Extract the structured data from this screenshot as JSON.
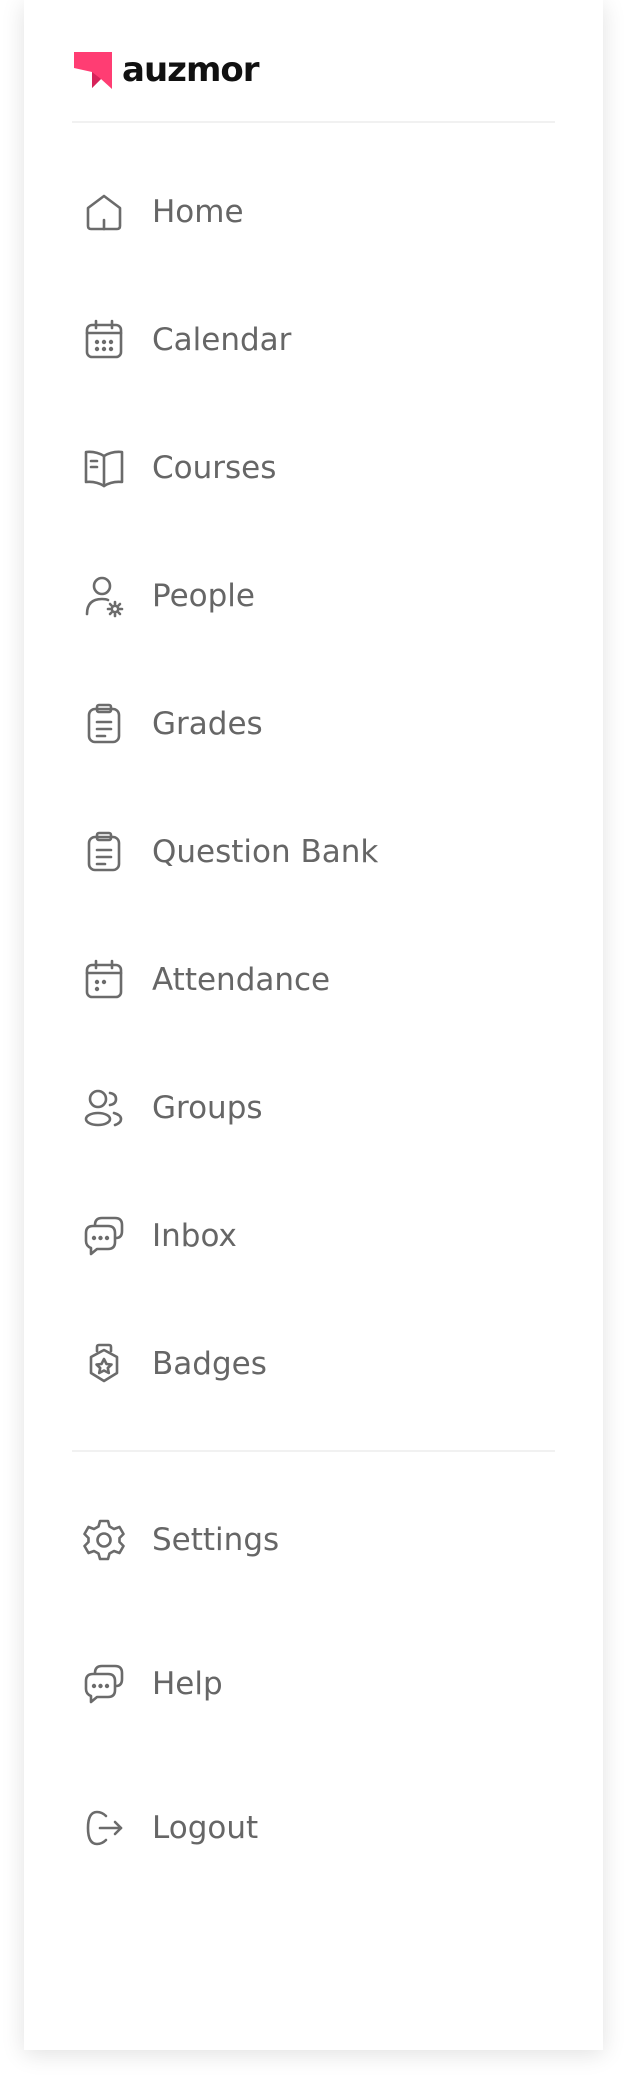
{
  "brand": {
    "name": "auzmor",
    "accent_color": "#ff3d73"
  },
  "colors": {
    "icon_stroke": "#6b6b6b",
    "label": "#666666",
    "divider": "#f1f1f1"
  },
  "nav": {
    "items": [
      {
        "label": "Home",
        "icon": "home-icon"
      },
      {
        "label": "Calendar",
        "icon": "calendar-icon"
      },
      {
        "label": "Courses",
        "icon": "book-open-icon"
      },
      {
        "label": "People",
        "icon": "user-gear-icon"
      },
      {
        "label": "Grades",
        "icon": "clipboard-icon"
      },
      {
        "label": "Question Bank",
        "icon": "clipboard-icon"
      },
      {
        "label": "Attendance",
        "icon": "calendar-check-icon"
      },
      {
        "label": "Groups",
        "icon": "users-icon"
      },
      {
        "label": "Inbox",
        "icon": "chat-bubbles-icon"
      },
      {
        "label": "Badges",
        "icon": "badge-icon"
      }
    ]
  },
  "footer_nav": {
    "items": [
      {
        "label": "Settings",
        "icon": "gear-icon"
      },
      {
        "label": "Help",
        "icon": "chat-bubbles-icon"
      },
      {
        "label": "Logout",
        "icon": "logout-icon"
      }
    ]
  }
}
